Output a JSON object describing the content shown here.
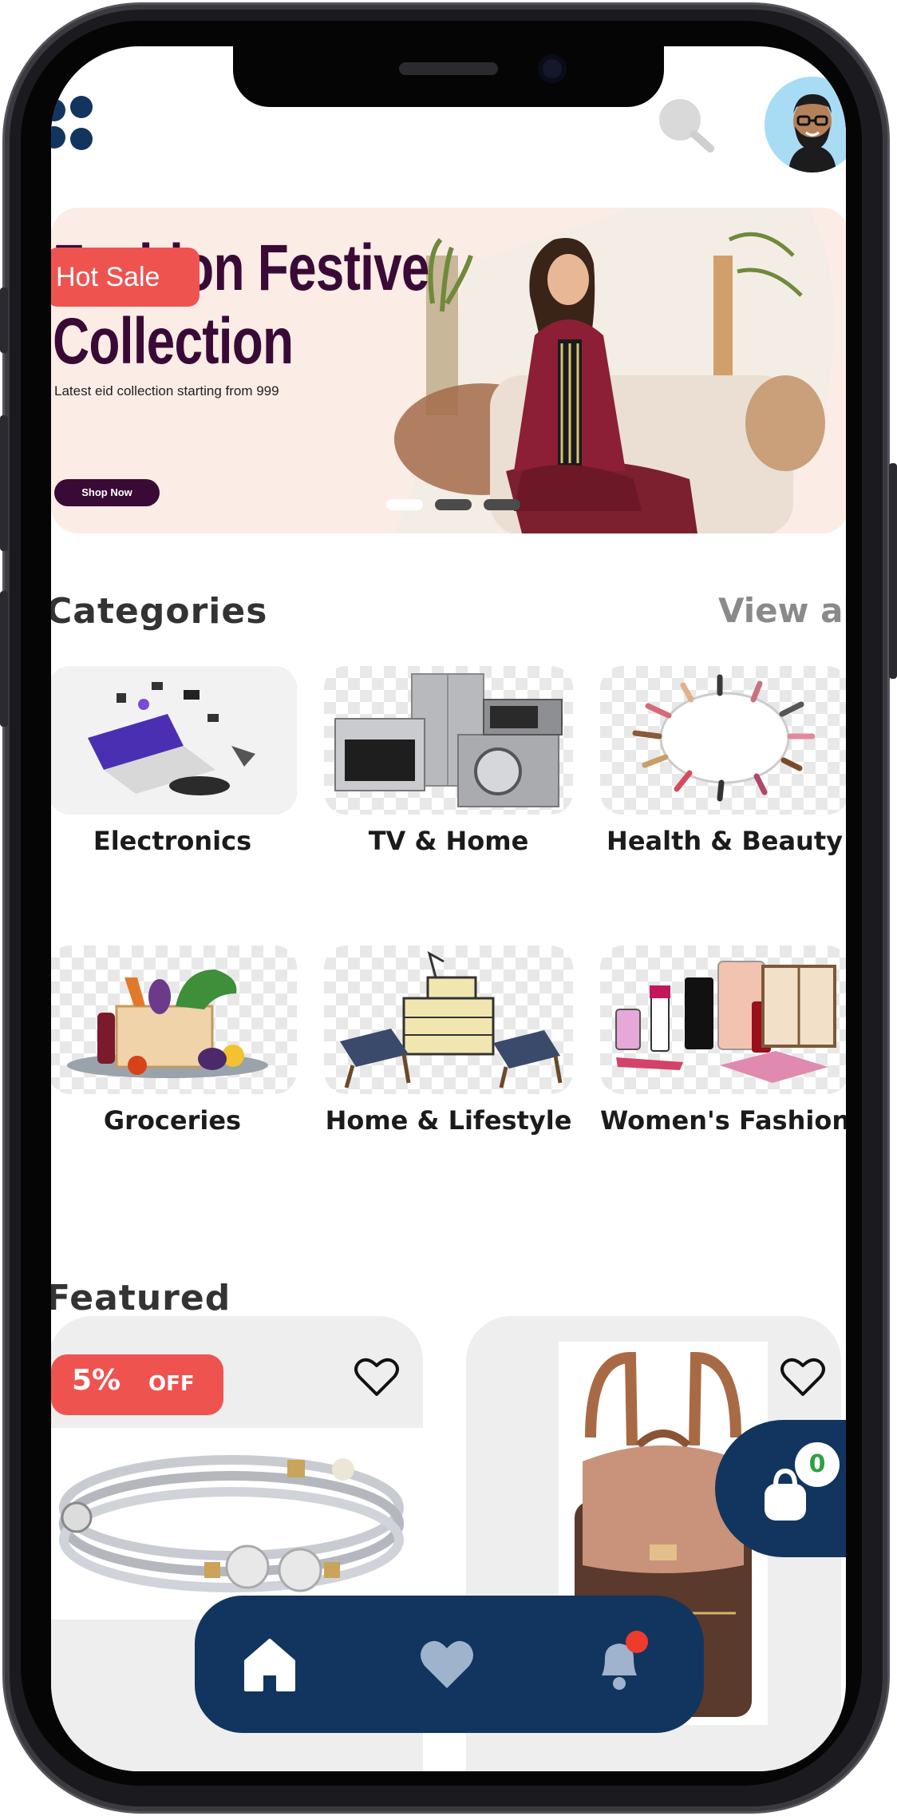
{
  "header": {
    "logo_icon": "app-logo-dots-icon",
    "search_icon": "search-icon",
    "avatar_icon": "user-avatar"
  },
  "banner": {
    "badge": "Hot Sale",
    "title": "Fashion Festive\nCollection",
    "subtitle": "Latest eid collection starting from 999",
    "cta": "Shop Now",
    "slide_count": 3,
    "active_slide": 1
  },
  "categories": {
    "title": "Categories",
    "view_all": "View all",
    "items": [
      {
        "label": "Electronics"
      },
      {
        "label": "TV & Home"
      },
      {
        "label": "Health & Beauty"
      },
      {
        "label": "Groceries"
      },
      {
        "label": "Home & Lifestyle"
      },
      {
        "label": "Women's Fashion"
      }
    ]
  },
  "featured": {
    "title": "Featured",
    "products": [
      {
        "discount_value": "5%",
        "discount_label": "OFF",
        "image": "bracelet",
        "favorite_icon": "heart-outline-icon"
      },
      {
        "image": "backpack",
        "favorite_icon": "heart-outline-icon"
      }
    ]
  },
  "cart": {
    "icon": "shopping-bag-icon",
    "count": "0"
  },
  "bottom_nav": {
    "items": [
      {
        "name": "home",
        "icon": "home-icon",
        "active": true
      },
      {
        "name": "favorites",
        "icon": "heart-icon",
        "active": false
      },
      {
        "name": "notifications",
        "icon": "bell-icon",
        "active": false,
        "has_dot": true
      }
    ]
  },
  "colors": {
    "primary": "#12355f",
    "accent_red": "#ef5350",
    "banner_text": "#3a0a36",
    "banner_bg": "#fbece6",
    "badge_green": "#2ea043"
  }
}
